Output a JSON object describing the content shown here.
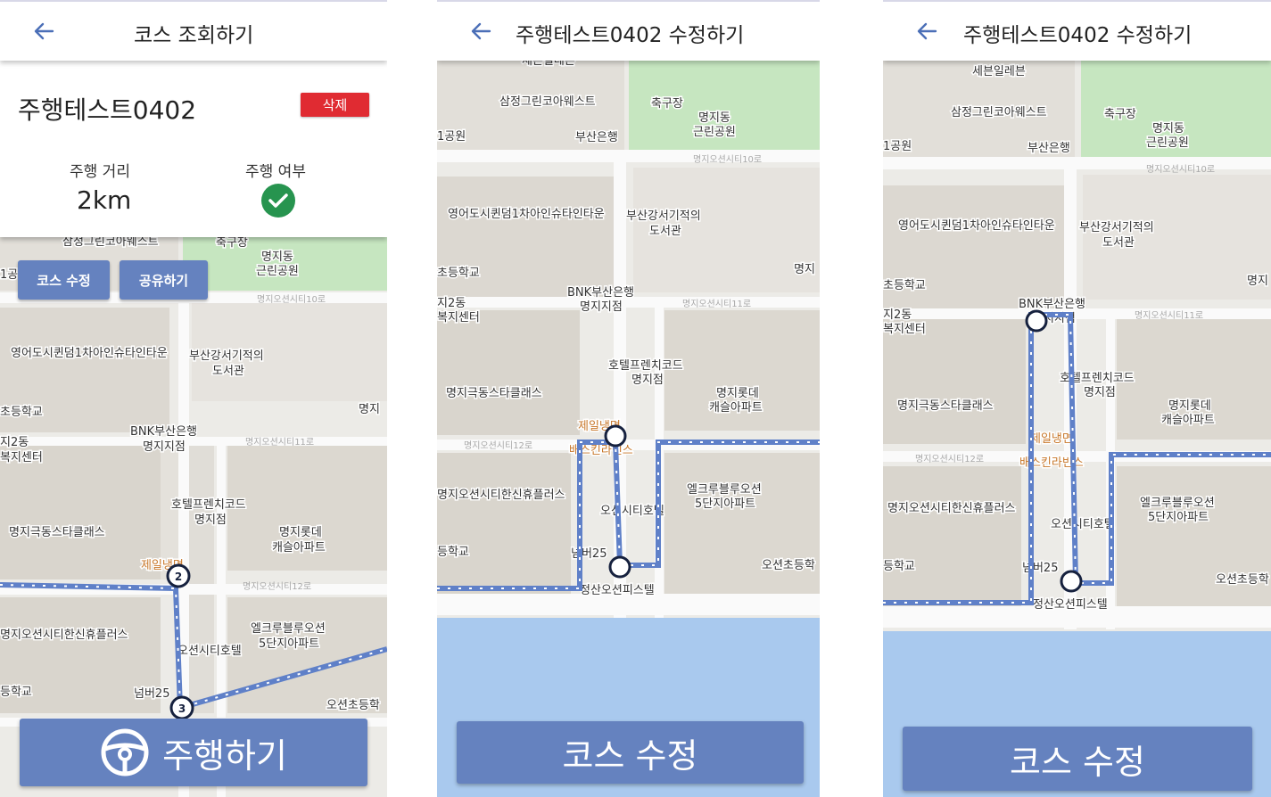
{
  "colors": {
    "accent": "#6582bf",
    "danger": "#e02b32",
    "success": "#27944f",
    "route": "#5f80c8",
    "water": "#a9c9ee",
    "park": "#c6e6c0"
  },
  "view_screen": {
    "title": "코스 조회하기",
    "course_name": "주행테스트0402",
    "delete_label": "삭제",
    "distance_label": "주행 거리",
    "distance_value": "2km",
    "driven_label": "주행 여부",
    "driven": true,
    "edit_course_label": "코스 수정",
    "share_label": "공유하기",
    "drive_label": "주행하기",
    "waypoints": [
      "2",
      "3"
    ]
  },
  "edit_screen_1": {
    "title": "주행테스트0402 수정하기",
    "button_label": "코스 수정"
  },
  "edit_screen_2": {
    "title": "주행테스트0402 수정하기",
    "button_label": "코스 수정"
  },
  "map": {
    "pois": {
      "seven": "세븐일레븐",
      "samjeong": "삼정그린코아웨스트",
      "soccer": "축구장",
      "park": "명지동\n근린공원",
      "park1": "1공원",
      "busanbank": "부산은행",
      "young": "영어도시퀸덤1차아인슈타인타운",
      "library": "부산강서기적의\n도서관",
      "elem": "초등학교",
      "center": "지2동\n복지센터",
      "bnk": "BNK부산은행\n명지지점",
      "hotel": "호텔프렌치코드\n명지점",
      "lotte": "명지롯데\n캐슬아파트",
      "geukdong": "명지극동스타클래스",
      "jeil": "제일냉면",
      "baeskin": "배스킨라빈스",
      "hanshin": "명지오션시티한신휴플러스",
      "oceanhotel": "오션시티호텔",
      "elcru": "엘크루블루오션\n5단지아파트",
      "school2": "등학교",
      "numbur": "넘버25",
      "oceanelem": "오션초등학",
      "jeongsan": "정산오션피스텔",
      "myeongji": "명지",
      "road10": "명지오션시티10로",
      "road11": "명지오션시티11로",
      "road12": "명지오션시티12로"
    }
  }
}
